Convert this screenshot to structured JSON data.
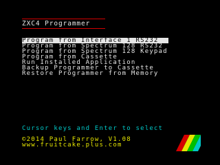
{
  "header": {
    "title": "ZXC4 Programmer"
  },
  "menu": {
    "items": [
      {
        "label": "Program from Interface 1 RS232",
        "selected": true
      },
      {
        "label": "Program from Spectrum 128 RS232",
        "selected": false
      },
      {
        "label": "Program from Spectrum 128 Keypad",
        "selected": false
      },
      {
        "label": "Program from Cassette",
        "selected": false
      },
      {
        "label": "Run Installed Application",
        "selected": false
      },
      {
        "label": "Backup Programmer to Cassette",
        "selected": false
      },
      {
        "label": "Restore Programmer from Memory",
        "selected": false
      }
    ]
  },
  "footer": {
    "hint": "Cursor keys and Enter to select",
    "credit": "©2014 Paul Farrow, V1.08",
    "url": "www.fruitcake.plus.com"
  },
  "colors": {
    "background": "#000000",
    "text": "#e6e6e6",
    "rule": "#d40000",
    "hint": "#00c8c8",
    "credit": "#e6e600",
    "stripes": [
      "#d40000",
      "#e6e600",
      "#00c000",
      "#00c8c8"
    ]
  }
}
